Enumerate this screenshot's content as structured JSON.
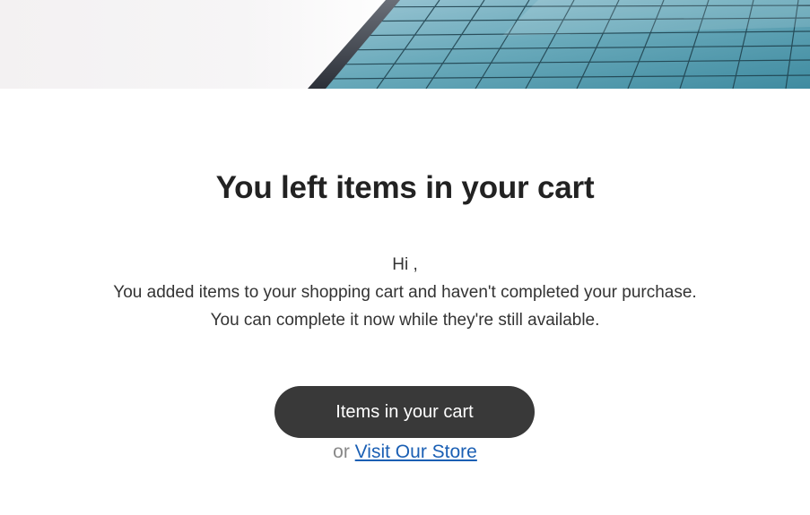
{
  "email": {
    "headline": "You left items in your cart",
    "greeting": "Hi ,",
    "message_line1": "You added items to your shopping cart and haven't completed your purchase.",
    "message_line2": "You can complete it now while they're still available.",
    "cta_label": "Items in your cart",
    "alt_prefix": "or",
    "alt_link_label": "Visit Our Store"
  },
  "hero": {
    "image": "glass-building-facade-banner"
  },
  "colors": {
    "button_bg": "#393939",
    "button_text": "#ffffff",
    "link": "#1a5fb4",
    "headline": "#222222",
    "glass": "#5a9db0"
  }
}
